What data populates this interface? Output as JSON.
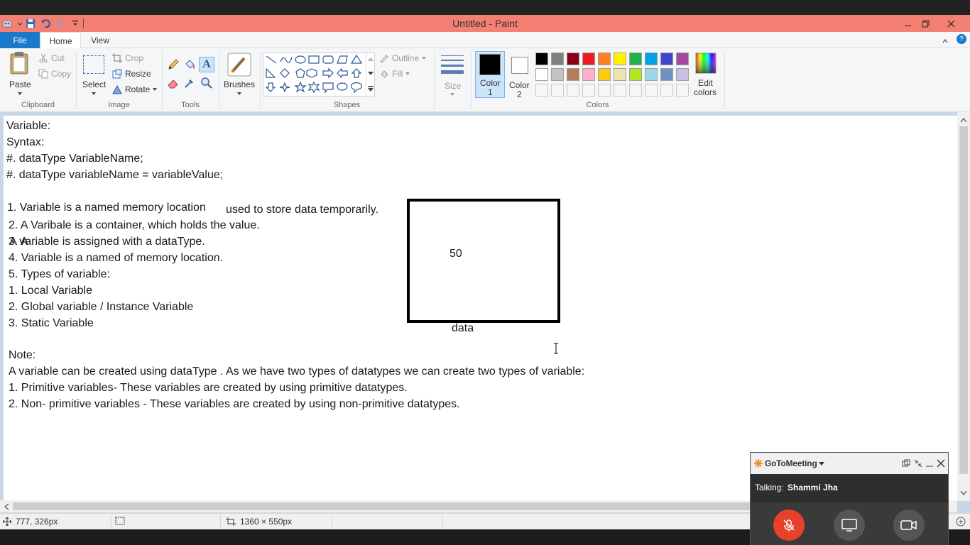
{
  "window": {
    "title": "Untitled - Paint",
    "minimize_icon": "minimize-icon",
    "restore_icon": "restore-icon",
    "close_icon": "close-icon"
  },
  "ribbon_tabs": [
    "File",
    "Home",
    "View"
  ],
  "clipboard": {
    "paste": "Paste",
    "cut": "Cut",
    "copy": "Copy",
    "group": "Clipboard"
  },
  "image": {
    "select": "Select",
    "crop": "Crop",
    "resize": "Resize",
    "rotate": "Rotate",
    "group": "Image"
  },
  "tools": {
    "group": "Tools"
  },
  "brushes": {
    "label": "Brushes"
  },
  "shapes": {
    "outline": "Outline",
    "fill": "Fill",
    "group": "Shapes"
  },
  "size": {
    "label": "Size"
  },
  "colors": {
    "color1_label": "Color",
    "color1_num": "1",
    "color2_label": "Color",
    "color2_num": "2",
    "edit_label": "Edit",
    "edit_label2": "colors",
    "group": "Colors",
    "color1": "#000000",
    "color2": "#ffffff",
    "palette_row1": [
      "#000000",
      "#7f7f7f",
      "#880015",
      "#ed1c24",
      "#ff7f27",
      "#fff200",
      "#22b14c",
      "#00a2e8",
      "#3f48cc",
      "#a349a4"
    ],
    "palette_row2": [
      "#ffffff",
      "#c3c3c3",
      "#b97a57",
      "#ffaec9",
      "#ffc90e",
      "#efe4b0",
      "#b5e61d",
      "#99d9ea",
      "#7092be",
      "#c8bfe7"
    ]
  },
  "canvas": {
    "lines": {
      "l1": "Variable:",
      "l2": "Syntax:",
      "l3": "#. dataType VariableName;",
      "l4": "#. dataType variableName = variableValue;",
      "l5a": "1. Variable is a named memory location",
      "l5b": "used to store data temporarily.",
      "l6": "2. A Varibale is a container, which holds the value.",
      "l7": "3. A",
      "l7b": "A variable is assigned with a dataType.",
      "l8": "4. Variable is a named of memory location.",
      "l9": "5. Types of variable:",
      "l10": "1. Local Variable",
      "l11": "2. Global variable / Instance Variable",
      "l12": "3. Static Variable",
      "l13": "Note:",
      "l14": "A variable can be created using dataType . As we have two types of datatypes we can create two types of variable:",
      "l15": "1. Primitive variables- These variables are created by using primitive datatypes.",
      "l16": "2. Non- primitive variables - These variables are created by using non-primitive datatypes."
    },
    "box_value": "50",
    "box_label": "data"
  },
  "status": {
    "cursor_pos": "777, 326px",
    "canvas_size": "1360 × 550px"
  },
  "gotomeeting": {
    "brand": "GoToMeeting",
    "talking_label": "Talking:",
    "talking_name": "Shammi Jha"
  }
}
